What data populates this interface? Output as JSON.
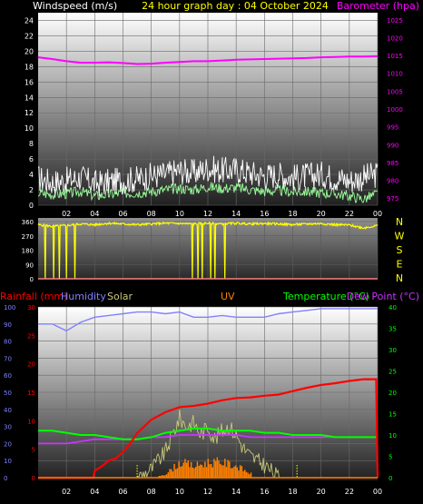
{
  "colors": {
    "windspeed": "#ffffff",
    "gust": "#ffffff",
    "avgwind": "#99ff99",
    "barometer": "#ff00ff",
    "direction": "#ffff00",
    "rain": "#ff0000",
    "humidity": "#8080ff",
    "solar": "#c8c878",
    "uv": "#ff8000",
    "temperature": "#00ff00",
    "dewpoint": "#cc33ff",
    "title": "#ffff00",
    "axis_left": "#ffffff",
    "axis_right": "#ff00ff"
  },
  "chart_data": [
    {
      "type": "line",
      "title": "24 hour graph day : 04 October 2024",
      "ylabel_left": "Windspeed (m/s)",
      "ylabel_right": "Barometer (hpa)",
      "y_left_ticks": [
        "0",
        "2",
        "4",
        "6",
        "8",
        "10",
        "12",
        "14",
        "16",
        "18",
        "20",
        "22",
        "24"
      ],
      "y_right_ticks": [
        "975",
        "980",
        "985",
        "990",
        "995",
        "1000",
        "1005",
        "1010",
        "1015",
        "1020",
        "1025"
      ],
      "x_ticks": [
        "02",
        "04",
        "06",
        "08",
        "10",
        "12",
        "14",
        "16",
        "18",
        "20",
        "22",
        "00"
      ],
      "ylim_left": [
        0,
        25
      ],
      "ylim_right": [
        973,
        1027
      ],
      "series": [
        {
          "name": "Windspeed (m/s)",
          "x": [
            0,
            1,
            2,
            3,
            4,
            5,
            6,
            7,
            8,
            9,
            10,
            11,
            12,
            13,
            14,
            15,
            16,
            17,
            18,
            19,
            20,
            21,
            22,
            23,
            24
          ],
          "values": [
            3.5,
            3.0,
            3.2,
            3.6,
            2.8,
            3.0,
            3.2,
            3.4,
            3.8,
            4.0,
            4.5,
            4.2,
            4.8,
            4.5,
            4.6,
            4.2,
            3.8,
            4.0,
            3.6,
            3.8,
            4.0,
            3.6,
            3.2,
            3.6,
            4.0
          ]
        },
        {
          "name": "Barometer (hpa)",
          "x": [
            0,
            1,
            2,
            3,
            4,
            5,
            6,
            7,
            8,
            9,
            10,
            11,
            12,
            13,
            14,
            15,
            16,
            17,
            18,
            19,
            20,
            21,
            22,
            23,
            24
          ],
          "values": [
            1014.5,
            1014.0,
            1013.4,
            1013.0,
            1013.0,
            1013.1,
            1012.9,
            1012.6,
            1012.7,
            1013.0,
            1013.2,
            1013.4,
            1013.4,
            1013.6,
            1013.8,
            1013.9,
            1014.0,
            1014.1,
            1014.2,
            1014.3,
            1014.5,
            1014.6,
            1014.7,
            1014.7,
            1014.8
          ]
        },
        {
          "name": "Average wind",
          "x": [
            0,
            1,
            2,
            3,
            4,
            5,
            6,
            7,
            8,
            9,
            10,
            11,
            12,
            13,
            14,
            15,
            16,
            17,
            18,
            19,
            20,
            21,
            22,
            23,
            24
          ],
          "values": [
            1.6,
            1.4,
            1.5,
            1.8,
            1.2,
            1.4,
            1.6,
            1.6,
            1.8,
            2.0,
            2.2,
            2.0,
            2.4,
            2.2,
            2.3,
            2.0,
            1.8,
            1.9,
            1.7,
            1.8,
            1.6,
            1.5,
            1.2,
            0.8,
            1.5
          ]
        }
      ]
    },
    {
      "type": "line",
      "ylabel_left": "",
      "y_left_ticks": [
        "0",
        "90",
        "180",
        "270",
        "360"
      ],
      "y_right_labels": [
        "N",
        "W",
        "S",
        "E",
        "N"
      ],
      "ylim_left": [
        0,
        360
      ],
      "series": [
        {
          "name": "Wind direction",
          "x": [
            0,
            1,
            2,
            3,
            4,
            5,
            6,
            7,
            8,
            9,
            10,
            11,
            12,
            13,
            14,
            15,
            16,
            17,
            18,
            19,
            20,
            21,
            22,
            23,
            24
          ],
          "values": [
            340,
            330,
            335,
            345,
            340,
            350,
            345,
            340,
            345,
            350,
            348,
            345,
            350,
            345,
            350,
            345,
            348,
            345,
            340,
            345,
            348,
            340,
            338,
            320,
            335
          ]
        }
      ],
      "drops_to_zero_hours": [
        0.5,
        1.1,
        1.5,
        2.0,
        2.6,
        10.9,
        11.3,
        11.6,
        12.2,
        12.5,
        13.2
      ]
    },
    {
      "type": "line",
      "ylabel_left": "Rainfall (mm)",
      "legend": [
        "Rainfall (mm)",
        "Humidity",
        "Solar",
        "UV",
        "Temperature (°C)",
        "Dew Point (°C)"
      ],
      "y_humidity_ticks": [
        "0",
        "10",
        "20",
        "30",
        "40",
        "50",
        "60",
        "70",
        "80",
        "90",
        "100"
      ],
      "y_rain_ticks": [
        "0",
        "5",
        "10",
        "15",
        "20",
        "25",
        "30"
      ],
      "y_temp_ticks": [
        "0",
        "5",
        "10",
        "15",
        "20",
        "25",
        "30",
        "35",
        "40"
      ],
      "x_ticks": [
        "02",
        "04",
        "06",
        "08",
        "10",
        "12",
        "14",
        "16",
        "18",
        "20",
        "22",
        "00"
      ],
      "ylim_humidity": [
        0,
        100
      ],
      "ylim_rain": [
        0,
        30
      ],
      "ylim_temp": [
        0,
        40
      ],
      "series": [
        {
          "name": "Humidity",
          "x": [
            0,
            1,
            2,
            3,
            4,
            5,
            6,
            7,
            8,
            9,
            10,
            11,
            12,
            13,
            14,
            15,
            16,
            17,
            18,
            19,
            20,
            21,
            22,
            23,
            24
          ],
          "values": [
            90,
            90,
            86,
            91,
            94,
            95,
            96,
            97,
            97,
            96,
            97,
            94,
            94,
            95,
            94,
            94,
            94,
            96,
            97,
            98,
            99,
            99,
            99,
            99,
            99
          ]
        },
        {
          "name": "Rainfall (mm)",
          "x": [
            0,
            3.9,
            4.0,
            4.5,
            5.0,
            5.5,
            6.0,
            6.5,
            7.0,
            7.5,
            8.0,
            9.0,
            10.0,
            11.0,
            12.0,
            13.0,
            14.0,
            15.0,
            16.0,
            17.0,
            18.0,
            19.0,
            20.0,
            21.0,
            22.0,
            23.0,
            23.9,
            24.0
          ],
          "values": [
            0,
            0,
            1.2,
            2.0,
            3.0,
            3.4,
            4.5,
            6.0,
            7.8,
            9.0,
            10.2,
            11.5,
            12.4,
            12.6,
            13.0,
            13.6,
            14.0,
            14.1,
            14.4,
            14.6,
            15.2,
            15.8,
            16.3,
            16.6,
            17.0,
            17.3,
            17.3,
            0
          ]
        },
        {
          "name": "Temperature (°C)",
          "x": [
            0,
            1,
            2,
            3,
            4,
            5,
            6,
            7,
            8,
            9,
            10,
            11,
            12,
            13,
            14,
            15,
            16,
            17,
            18,
            19,
            20,
            21,
            22,
            23,
            24
          ],
          "values": [
            11,
            11,
            10.5,
            10,
            10,
            9.5,
            9,
            9,
            9.5,
            10.5,
            11,
            11.5,
            11.5,
            11,
            11,
            11,
            10.5,
            10.5,
            10,
            10,
            10,
            9.5,
            9.5,
            9.5,
            9.5
          ]
        },
        {
          "name": "Dew Point (°C)",
          "x": [
            0,
            1,
            2,
            3,
            4,
            5,
            6,
            7,
            8,
            9,
            10,
            11,
            12,
            13,
            14,
            15,
            16,
            17,
            18,
            19,
            20,
            21,
            22,
            23,
            24
          ],
          "values": [
            8,
            8,
            8,
            8.5,
            9,
            9,
            9,
            9,
            9.5,
            9.5,
            10,
            10,
            10,
            10,
            10,
            9.5,
            9.5,
            9.5,
            9.5,
            9.5,
            9.5,
            9.5,
            9.5,
            9.5,
            9.5
          ]
        },
        {
          "name": "Solar",
          "x": [
            0,
            7,
            8,
            9,
            9.5,
            10,
            10.5,
            11,
            11.5,
            12,
            12.5,
            13,
            13.5,
            14,
            14.5,
            15,
            16,
            17,
            24
          ],
          "values": [
            0,
            0,
            2,
            6,
            10,
            14,
            12,
            13,
            10,
            12,
            9,
            11,
            12,
            10,
            7,
            5,
            3,
            0,
            0
          ]
        },
        {
          "name": "UV",
          "x": [
            0,
            8,
            9,
            10,
            11,
            12,
            13,
            14,
            15,
            16,
            24
          ],
          "values": [
            0,
            0,
            1,
            4,
            3,
            4,
            4,
            3,
            1,
            0,
            0
          ]
        }
      ]
    }
  ]
}
